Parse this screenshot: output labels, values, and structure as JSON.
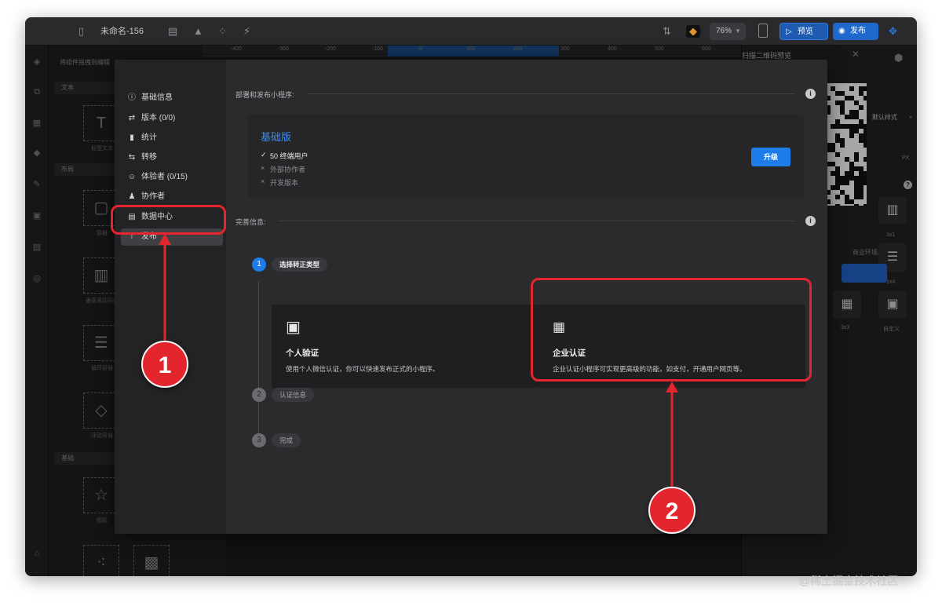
{
  "topbar": {
    "doc_title": "未命名-156",
    "zoom": "76%",
    "preview_label": "预览",
    "publish_label": "发布"
  },
  "ruler": {
    "ticks": [
      "-400",
      "-300",
      "-200",
      "-100",
      "0",
      "100",
      "200",
      "300",
      "400",
      "500",
      "600",
      "700"
    ]
  },
  "component_panel": {
    "heading": "将组件拖拽到编辑",
    "groups": [
      "文本",
      "布局",
      "基础"
    ],
    "tiles": [
      "标签文本",
      "容器",
      "垂直滚动容器",
      "循环容器",
      "浮动容器",
      "图标"
    ]
  },
  "right_panel": {
    "qr_title": "扫描二维码预览",
    "style_select": "默认样式",
    "input_unit": "PX",
    "layout_labels": [
      "3x1",
      "1x4",
      "3x3",
      "自定义"
    ],
    "env_note": "商业环境。"
  },
  "modal": {
    "nav": [
      {
        "icon": "info-icon",
        "label": "基础信息"
      },
      {
        "icon": "swap-icon",
        "label": "版本 (0/0)"
      },
      {
        "icon": "bar-chart-icon",
        "label": "统计"
      },
      {
        "icon": "transfer-icon",
        "label": "转移"
      },
      {
        "icon": "tester-icon",
        "label": "体验者 (0/15)"
      },
      {
        "icon": "team-icon",
        "label": "协作者"
      },
      {
        "icon": "table-icon",
        "label": "数据中心"
      },
      {
        "icon": "upload-icon",
        "label": "发布"
      }
    ],
    "active_nav": "发布",
    "deploy_heading": "部署和发布小程序:",
    "plan": {
      "name": "基础版",
      "features": [
        {
          "mark": "✓",
          "label": "50 终端用户",
          "enabled": true
        },
        {
          "mark": "×",
          "label": "外部协作者",
          "enabled": false
        },
        {
          "mark": "×",
          "label": "开发版本",
          "enabled": false
        }
      ],
      "upgrade_label": "升级"
    },
    "complete_heading": "完善信息:",
    "steps": [
      {
        "num": "1",
        "label": "选择转正类型",
        "state": "current"
      },
      {
        "num": "2",
        "label": "认证信息",
        "state": "idle"
      },
      {
        "num": "3",
        "label": "完成",
        "state": "idle"
      }
    ],
    "cert_options": [
      {
        "icon": "person-id-icon",
        "title": "个人验证",
        "desc": "使用个人微信认证，你可以快速发布正式的小程序。"
      },
      {
        "icon": "building-icon",
        "title": "企业认证",
        "desc": "企业认证小程序可实现更高级的功能，如支付，开通用户网页等。"
      }
    ]
  },
  "annotations": {
    "badge_1": "1",
    "badge_2": "2",
    "highlight_color": "#e3262e"
  },
  "watermark": "@稀土掘金技术社区"
}
